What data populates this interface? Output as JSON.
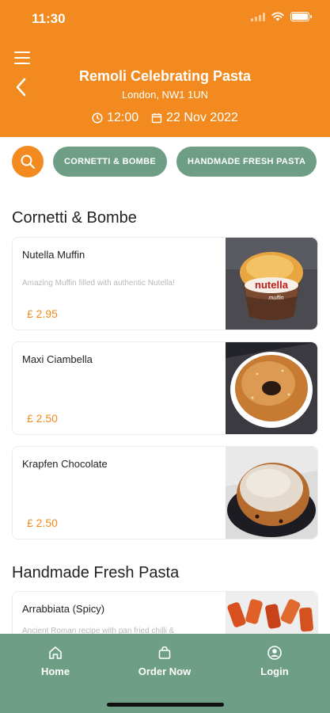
{
  "status": {
    "time": "11:30"
  },
  "header": {
    "title": "Remoli Celebrating Pasta",
    "location": "London, NW1 1UN",
    "time": "12:00",
    "date": "22 Nov 2022"
  },
  "filters": [
    "CORNETTI & BOMBE",
    "HANDMADE FRESH PASTA"
  ],
  "sections": [
    {
      "title": "Cornetti & Bombe",
      "items": [
        {
          "name": "Nutella Muffin",
          "description": "Amazing Muffin filled with authentic Nutella!",
          "price": "£ 2.95"
        },
        {
          "name": "Maxi Ciambella",
          "description": "",
          "price": "£ 2.50"
        },
        {
          "name": "Krapfen Chocolate",
          "description": "",
          "price": "£ 2.50"
        }
      ]
    },
    {
      "title": "Handmade Fresh Pasta",
      "items": [
        {
          "name": "Arrabbiata (Spicy)",
          "description": "Ancient Roman recipe with pan fried chilli &",
          "price": ""
        }
      ]
    }
  ],
  "nav": {
    "home": "Home",
    "order": "Order Now",
    "login": "Login"
  },
  "colors": {
    "brand": "#f28a20",
    "nav": "#6e9e86"
  }
}
